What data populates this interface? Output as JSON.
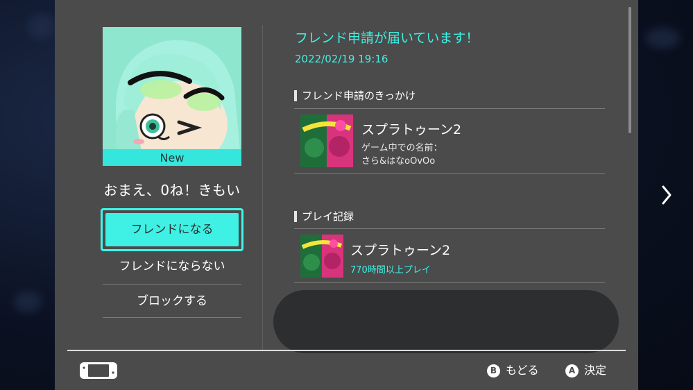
{
  "profile": {
    "badge": "New",
    "nickname": "おまえ、0ね！きもい"
  },
  "actions": {
    "accept_label": "フレンドになる",
    "decline_label": "フレンドにならない",
    "block_label": "ブロックする"
  },
  "request": {
    "title": "フレンド申請が届いています！",
    "date": "2022/02/19 19:16",
    "source_heading": "フレンド申請のきっかけ",
    "source_game": {
      "title": "スプラトゥーン2",
      "ingame_name_label": "ゲーム中での名前：",
      "ingame_name": "さら&はなoOvOo"
    }
  },
  "play_record": {
    "heading": "プレイ記録",
    "game_title": "スプラトゥーン2",
    "playtime": "770時間以上プレイ"
  },
  "footer": {
    "back_button": "B",
    "back_label": "もどる",
    "confirm_button": "A",
    "confirm_label": "決定"
  },
  "colors": {
    "accent": "#3ff0e4",
    "panel": "#4b4b4b",
    "text": "#ffffff"
  },
  "icons": {
    "console": "console-handheld-icon",
    "next": "chevron-right-icon"
  }
}
